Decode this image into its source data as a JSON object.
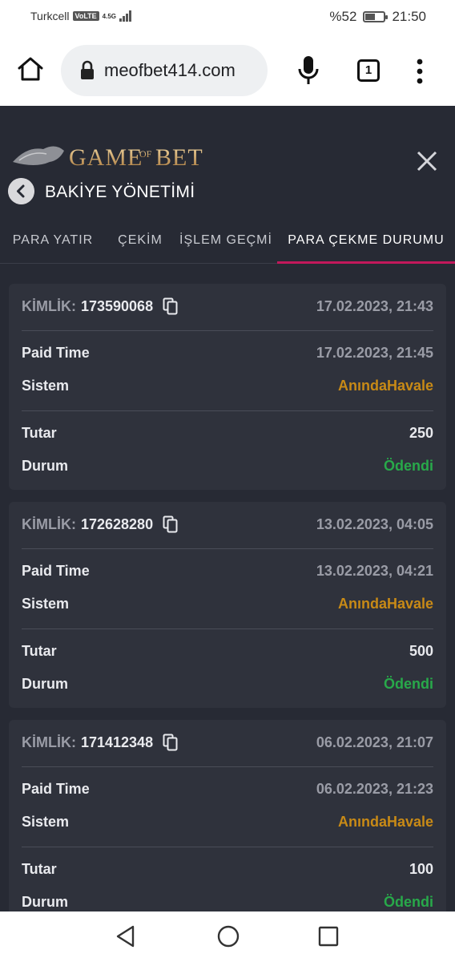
{
  "status_bar": {
    "carrier": "Turkcell",
    "volte": "VoLTE",
    "network": "4.5G",
    "battery": "%52",
    "time": "21:50",
    "battery_level": 0.52
  },
  "browser": {
    "url": "meofbet414.com",
    "tab_count": "1"
  },
  "site": {
    "logo_text": "GAMEOFBET",
    "section_title": "BAKİYE YÖNETİMİ",
    "tabs": [
      {
        "label": "PARA YATIR",
        "active": false
      },
      {
        "label": "ÇEKİM",
        "active": false
      },
      {
        "label": "İŞLEM GEÇMİ",
        "active": false
      },
      {
        "label": "PARA ÇEKME DURUMU",
        "active": true
      }
    ]
  },
  "labels": {
    "id": "KİMLİK:",
    "paid_time": "Paid Time",
    "system": "Sistem",
    "amount": "Tutar",
    "status": "Durum"
  },
  "withdrawals": [
    {
      "id": "173590068",
      "date": "17.02.2023, 21:43",
      "paid_time": "17.02.2023, 21:45",
      "system": "AnındaHavale",
      "amount": "250",
      "status": "Ödendi"
    },
    {
      "id": "172628280",
      "date": "13.02.2023, 04:05",
      "paid_time": "13.02.2023, 04:21",
      "system": "AnındaHavale",
      "amount": "500",
      "status": "Ödendi"
    },
    {
      "id": "171412348",
      "date": "06.02.2023, 21:07",
      "paid_time": "06.02.2023, 21:23",
      "system": "AnındaHavale",
      "amount": "100",
      "status": "Ödendi"
    }
  ],
  "colors": {
    "background": "#272a34",
    "card": "#2f323c",
    "accent": "#c2185b",
    "system_text": "#c88a16",
    "status_paid": "#28a94a"
  }
}
